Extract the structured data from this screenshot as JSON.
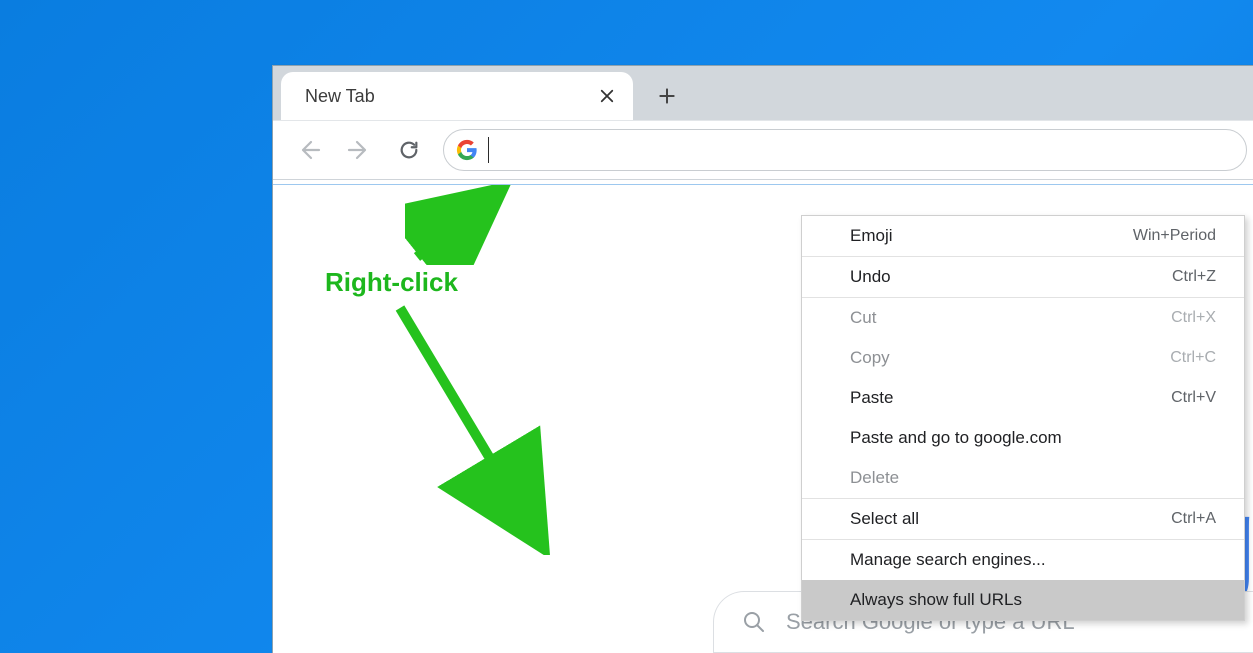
{
  "tab": {
    "title": "New Tab"
  },
  "searchbox": {
    "placeholder": "Search Google or type a URL"
  },
  "annotation": {
    "label": "Right-click"
  },
  "context_menu": {
    "items": [
      {
        "label": "Emoji",
        "shortcut": "Win+Period",
        "enabled": true
      },
      {
        "sep": true
      },
      {
        "label": "Undo",
        "shortcut": "Ctrl+Z",
        "enabled": true
      },
      {
        "sep": true
      },
      {
        "label": "Cut",
        "shortcut": "Ctrl+X",
        "enabled": false
      },
      {
        "label": "Copy",
        "shortcut": "Ctrl+C",
        "enabled": false
      },
      {
        "label": "Paste",
        "shortcut": "Ctrl+V",
        "enabled": true
      },
      {
        "label": "Paste and go to google.com",
        "shortcut": "",
        "enabled": true
      },
      {
        "label": "Delete",
        "shortcut": "",
        "enabled": false
      },
      {
        "sep": true
      },
      {
        "label": "Select all",
        "shortcut": "Ctrl+A",
        "enabled": true
      },
      {
        "sep": true
      },
      {
        "label": "Manage search engines...",
        "shortcut": "",
        "enabled": true
      },
      {
        "label": "Always show full URLs",
        "shortcut": "",
        "enabled": true,
        "highlighted": true
      }
    ]
  }
}
